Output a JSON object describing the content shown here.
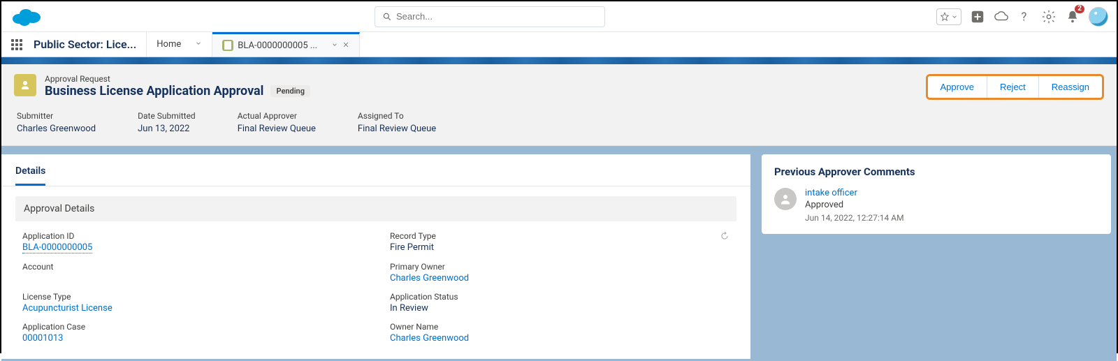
{
  "header": {
    "search_placeholder": "Search...",
    "notification_count": "2"
  },
  "appnav": {
    "app_name": "Public Sector: Lice...",
    "tabs": [
      {
        "label": "Home"
      },
      {
        "label": "BLA-0000000005 ..."
      }
    ]
  },
  "page": {
    "eyebrow": "Approval Request",
    "title": "Business License Application Approval",
    "status": "Pending",
    "actions": {
      "approve": "Approve",
      "reject": "Reject",
      "reassign": "Reassign"
    }
  },
  "summary": {
    "submitter_label": "Submitter",
    "submitter_value": "Charles Greenwood",
    "date_label": "Date Submitted",
    "date_value": "Jun 13, 2022",
    "approver_label": "Actual Approver",
    "approver_value": "Final Review Queue",
    "assigned_label": "Assigned To",
    "assigned_value": "Final Review Queue"
  },
  "details": {
    "tab_label": "Details",
    "section_title": "Approval Details",
    "fields": {
      "application_id_label": "Application ID",
      "application_id_value": "BLA-0000000005",
      "record_type_label": "Record Type",
      "record_type_value": "Fire Permit",
      "account_label": "Account",
      "account_value": "",
      "primary_owner_label": "Primary Owner",
      "primary_owner_value": "Charles Greenwood",
      "license_type_label": "License Type",
      "license_type_value": "Acupuncturist License",
      "app_status_label": "Application Status",
      "app_status_value": "In Review",
      "app_case_label": "Application Case",
      "app_case_value": "00001013",
      "owner_name_label": "Owner Name",
      "owner_name_value": "Charles Greenwood"
    }
  },
  "comments": {
    "title": "Previous Approver Comments",
    "items": [
      {
        "name": "intake officer",
        "status": "Approved",
        "time": "Jun 14, 2022, 12:27:14 AM"
      }
    ]
  }
}
